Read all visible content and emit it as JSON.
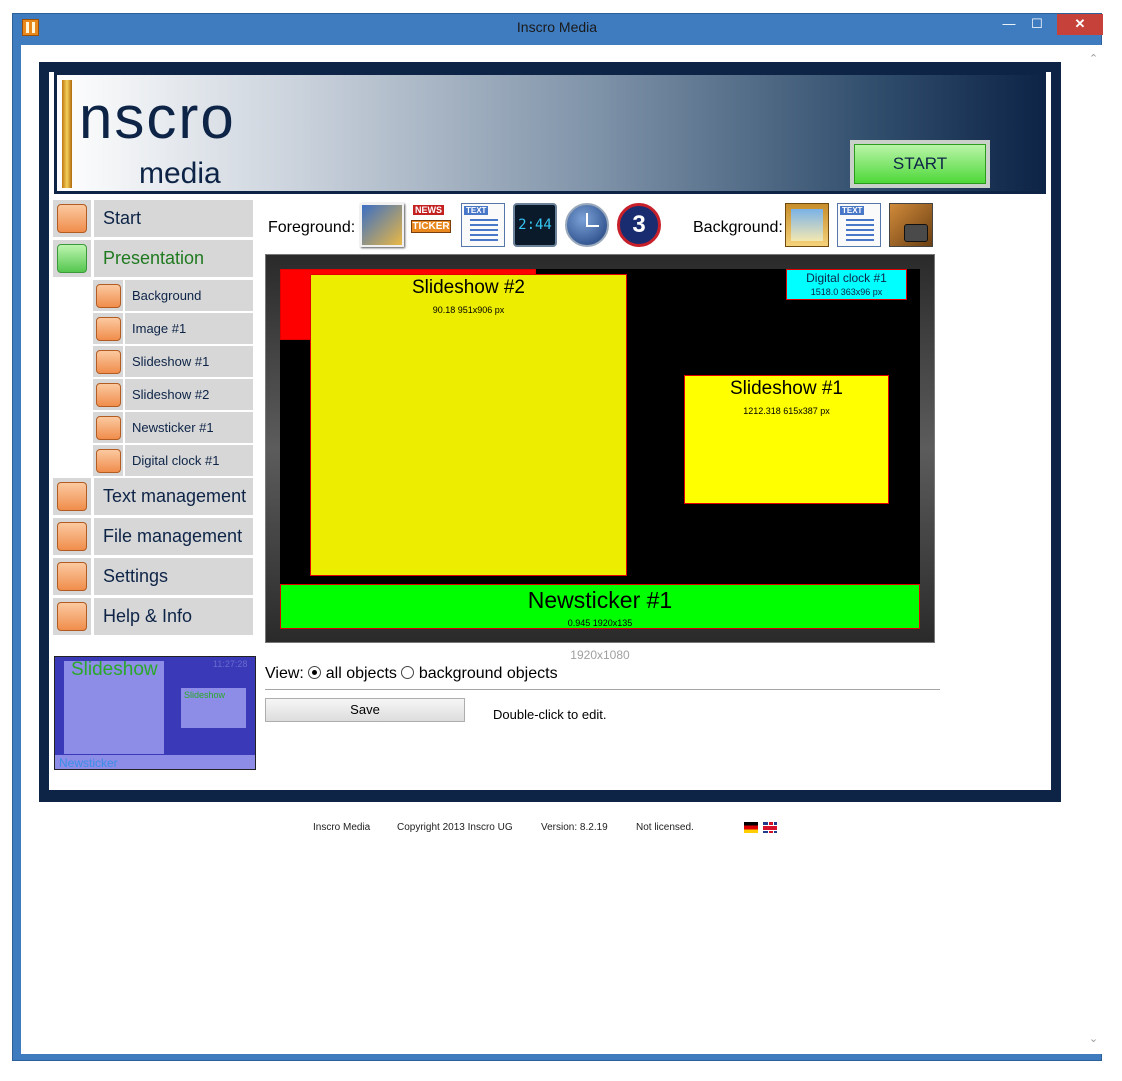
{
  "window": {
    "title": "Inscro Media",
    "min_glyph": "—",
    "max_glyph": "☐",
    "close_glyph": "✕"
  },
  "scroll": {
    "up": "⌃",
    "down": "⌄"
  },
  "logo": {
    "line1": "nscro",
    "line2": "media"
  },
  "start_button": {
    "label": "START"
  },
  "nav": {
    "start": "Start",
    "presentation": "Presentation",
    "sub": [
      "Background",
      "Image #1",
      "Slideshow #1",
      "Slideshow #2",
      "Newsticker #1",
      "Digital clock #1"
    ],
    "text_management": "Text management",
    "file_management": "File management",
    "settings": "Settings",
    "help": "Help & Info"
  },
  "preview": {
    "slideshow_big": "Slideshow",
    "slideshow_small": "Slideshow",
    "clock": "11:27:28",
    "newsticker": "Newsticker"
  },
  "toolbar": {
    "foreground_label": "Foreground:",
    "background_label": "Background:",
    "ticker_news": "NEWS",
    "ticker_text": "TICKER",
    "text_tag": "TEXT",
    "digital_time": "2:44",
    "countdown": "3"
  },
  "canvas": {
    "objects": {
      "slideshow2": {
        "name": "Slideshow #2",
        "info": "90.18 951x906 px"
      },
      "slideshow1": {
        "name": "Slideshow #1",
        "info": "1212.318 615x387 px"
      },
      "newsticker1": {
        "name": "Newsticker #1",
        "info": "0.945 1920x135"
      },
      "clock1": {
        "name": "Digital clock #1",
        "info": "1518.0 363x96 px"
      }
    },
    "resolution": "1920x1080"
  },
  "view": {
    "label": "View:",
    "all_objects": "all objects",
    "background_objects": "background objects",
    "selected": "all objects"
  },
  "actions": {
    "save": "Save",
    "hint": "Double-click to edit."
  },
  "footer": {
    "app": "Inscro Media",
    "copyright": "Copyright 2013 Inscro UG",
    "version": "Version: 8.2.19",
    "license": "Not licensed."
  },
  "colors": {
    "frame": "#0d2447",
    "titlebar": "#3e7bbf",
    "close": "#c7413b",
    "ticker": "#00ff00",
    "slideshow": "#ffff00",
    "clock": "#00ffff",
    "image": "#ff0000"
  }
}
